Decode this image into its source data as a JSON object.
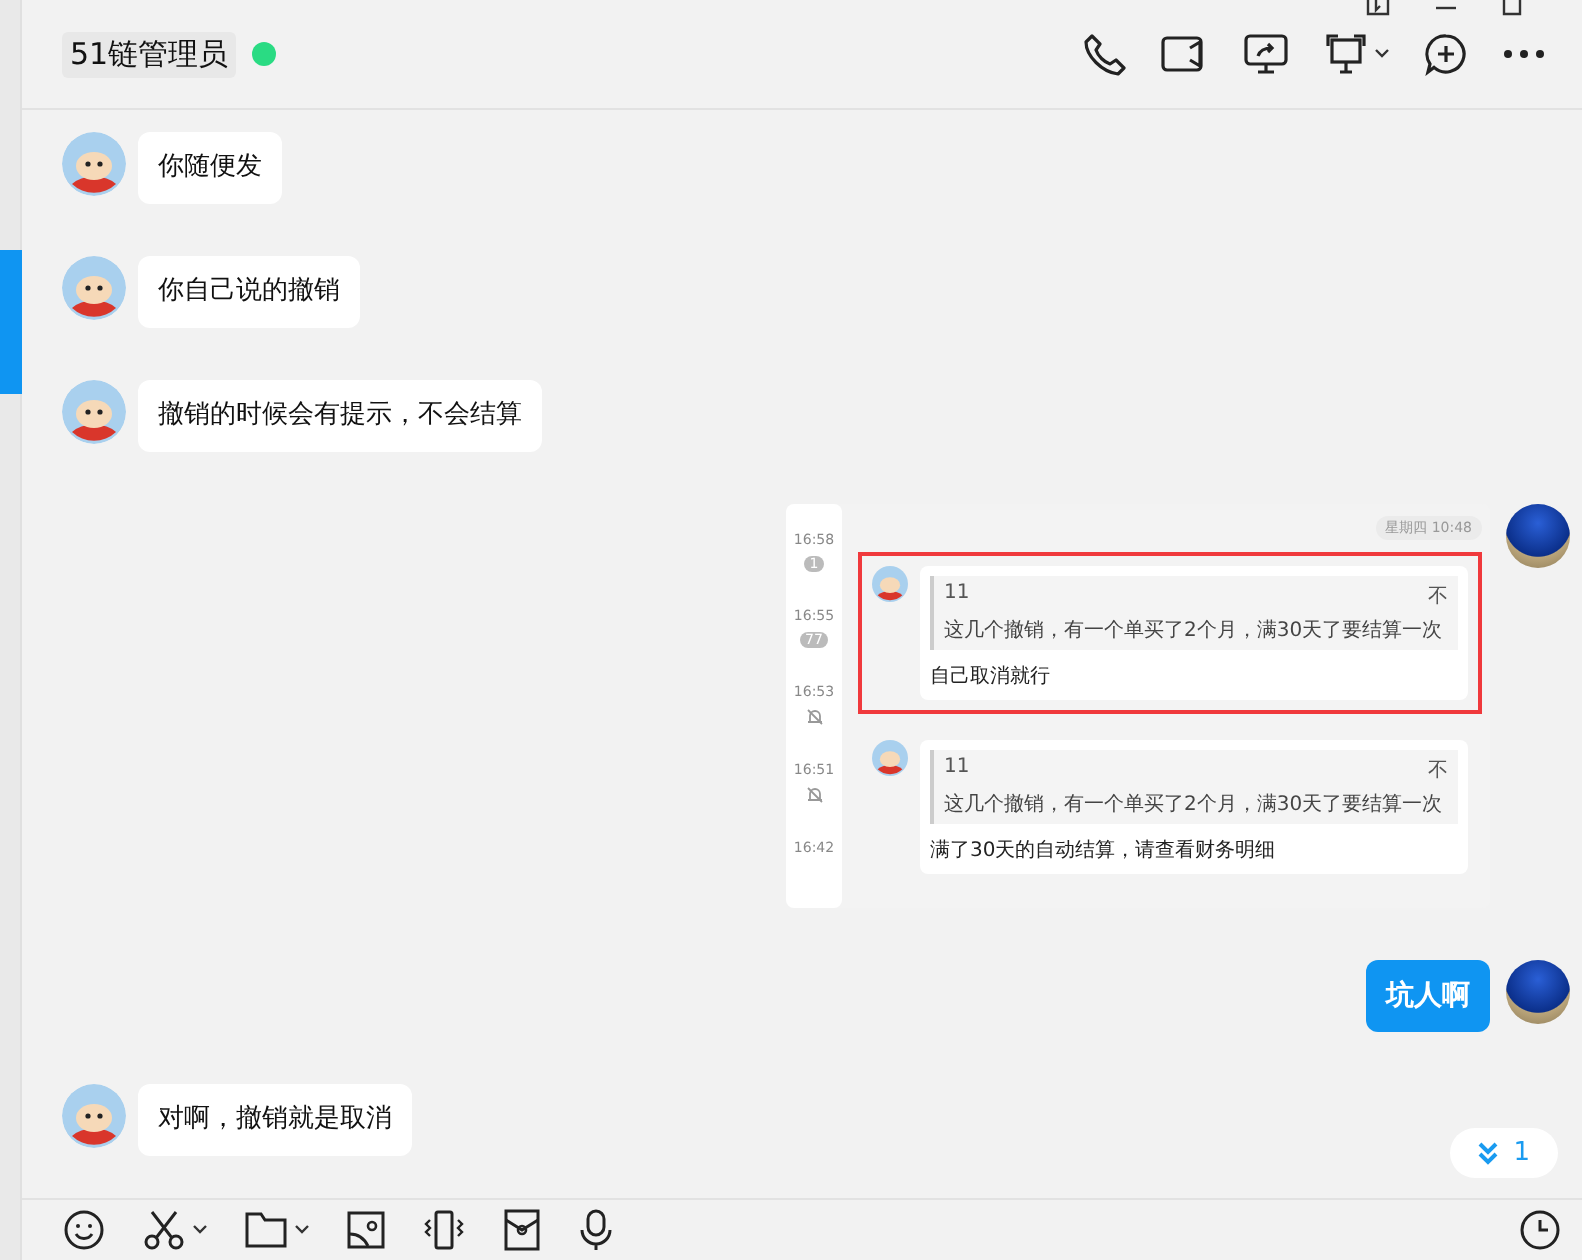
{
  "header": {
    "title": "51链管理员",
    "online": true
  },
  "messages": [
    {
      "kind": "text",
      "outgoing": false,
      "text": "你随便发"
    },
    {
      "kind": "text",
      "outgoing": false,
      "text": "你自己说的撤销"
    },
    {
      "kind": "text",
      "outgoing": false,
      "text": "撤销的时候会有提示，不会结算"
    },
    {
      "kind": "image",
      "outgoing": true,
      "shot": {
        "timeline": [
          {
            "time": "16:58",
            "badge": "1",
            "kind": "count"
          },
          {
            "time": "16:55",
            "badge": "77",
            "kind": "count"
          },
          {
            "time": "16:53",
            "kind": "muted"
          },
          {
            "time": "16:51",
            "kind": "muted"
          },
          {
            "time": "16:42",
            "kind": "none"
          }
        ],
        "date": "星期四 10:48",
        "cards": [
          {
            "quote_name": "11",
            "quote_mark": "不",
            "quote_text": "这几个撤销，有一个单买了2个月，满30天了要结算一次",
            "reply": "自己取消就行",
            "highlighted": true
          },
          {
            "quote_name": "11",
            "quote_mark": "不",
            "quote_text": "这几个撤销，有一个单买了2个月，满30天了要结算一次",
            "reply": "满了30天的自动结算，请查看财务明细",
            "highlighted": false
          }
        ]
      }
    },
    {
      "kind": "text",
      "outgoing": true,
      "text": "坑人啊"
    },
    {
      "kind": "text",
      "outgoing": false,
      "text": "对啊，撤销就是取消"
    }
  ],
  "new_messages": "1"
}
